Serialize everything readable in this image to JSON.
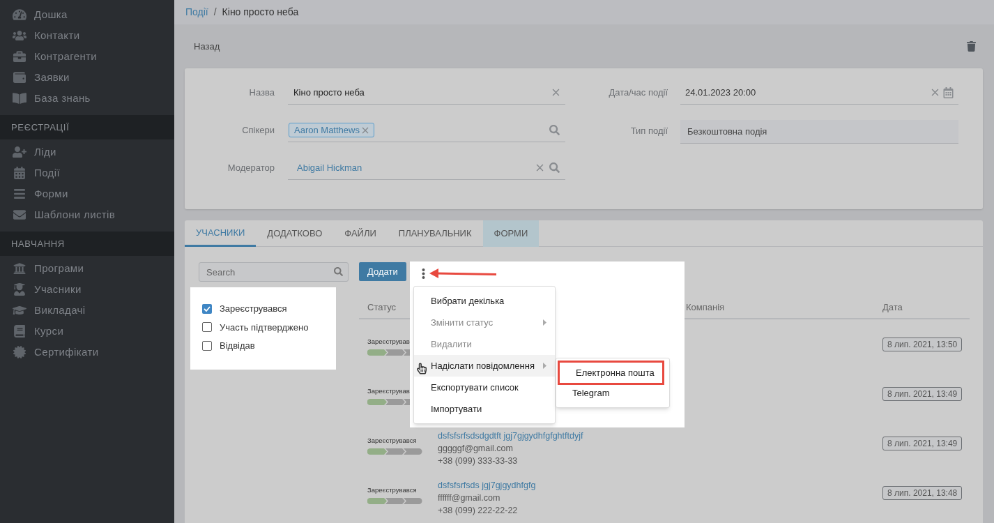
{
  "sidebar": {
    "sections": [
      {
        "items": [
          {
            "label": "Дошка"
          },
          {
            "label": "Контакти"
          },
          {
            "label": "Контрагенти"
          },
          {
            "label": "Заявки"
          },
          {
            "label": "База знань"
          }
        ]
      },
      {
        "heading": "РЕЄСТРАЦІЇ",
        "items": [
          {
            "label": "Ліди"
          },
          {
            "label": "Події"
          },
          {
            "label": "Форми"
          },
          {
            "label": "Шаблони листів"
          }
        ]
      },
      {
        "heading": "НАВЧАННЯ",
        "items": [
          {
            "label": "Програми"
          },
          {
            "label": "Учасники"
          },
          {
            "label": "Викладачі"
          },
          {
            "label": "Курси"
          },
          {
            "label": "Сертифікати"
          }
        ]
      }
    ]
  },
  "breadcrumb": [
    {
      "label": "Події",
      "link": true
    },
    {
      "label": "Кіно просто неба",
      "link": false
    }
  ],
  "breadcrumb_separator": "/",
  "back_label": "Назад",
  "form": {
    "left": [
      {
        "label": "Назва",
        "kind": "text",
        "value": "Кіно просто неба",
        "clearable": true,
        "searchable": false
      },
      {
        "label": "Спікери",
        "kind": "chips",
        "chips": [
          "Aaron Matthews"
        ],
        "clearable": false,
        "searchable": true
      },
      {
        "label": "Модератор",
        "kind": "link",
        "value": "Abigail Hickman",
        "clearable": true,
        "searchable": true
      }
    ],
    "right": [
      {
        "label": "Дата/час події",
        "kind": "date",
        "value": "24.01.2023 20:00",
        "clearable": true
      },
      {
        "label": "Тип події",
        "kind": "readonly",
        "value": "Безкоштовна подія",
        "clearable": false
      }
    ]
  },
  "tabs": [
    {
      "label": "УЧАСНИКИ",
      "selected": true,
      "highlighted": false
    },
    {
      "label": "ДОДАТКОВО",
      "selected": false,
      "highlighted": false
    },
    {
      "label": "ФАЙЛИ",
      "selected": false,
      "highlighted": false
    },
    {
      "label": "ПЛАНУВАЛЬНИК",
      "selected": false,
      "highlighted": false
    },
    {
      "label": "ФОРМИ",
      "selected": false,
      "highlighted": true
    }
  ],
  "search": {
    "placeholder": "Search"
  },
  "filters": [
    {
      "label": "Зареєструвався",
      "checked": true
    },
    {
      "label": "Участь підтверджено",
      "checked": false
    },
    {
      "label": "Відвідав",
      "checked": false
    }
  ],
  "add_button": "Додати",
  "table": {
    "columns": [
      "Статус",
      "Компанія",
      "Дата"
    ],
    "rows": [
      {
        "status": "Зареєстрував",
        "level": 0.33,
        "date": "8 лип. 2021, 13:50"
      },
      {
        "status": "Зареєстрував",
        "level": 0.33,
        "date": "8 лип. 2021, 13:49"
      },
      {
        "status": "Зареєструвався",
        "level": 0.33,
        "name": "dsfsfsrfsdsdgdtft jgj7gjgydhfgfghtftdyjf",
        "email": "gggggf@gmail.com",
        "phone": "+38 (099) 333-33-33",
        "date": "8 лип. 2021, 13:49"
      },
      {
        "status": "Зареєструвався",
        "level": 0.33,
        "name": "dsfsfsrfsds jgj7gjgydhfgfg",
        "email": "ffffff@gmail.com",
        "phone": "+38 (099) 222-22-22",
        "date": "8 лип. 2021, 13:48"
      }
    ]
  },
  "menu": {
    "items": [
      {
        "label": "Вибрати декілька",
        "disabled": false,
        "submenu": false,
        "hovered": false
      },
      {
        "label": "Змінити статус",
        "disabled": true,
        "submenu": true,
        "hovered": false
      },
      {
        "label": "Видалити",
        "disabled": true,
        "submenu": false,
        "hovered": false
      },
      {
        "label": "Надіслати повідомлення",
        "disabled": false,
        "submenu": true,
        "hovered": true
      },
      {
        "label": "Експортувати список",
        "disabled": false,
        "submenu": false,
        "hovered": false
      },
      {
        "label": "Імпортувати",
        "disabled": false,
        "submenu": false,
        "hovered": false
      }
    ],
    "submenu": [
      {
        "label": "Електронна пошта",
        "highlighted": true
      },
      {
        "label": "Telegram",
        "highlighted": false
      }
    ]
  }
}
